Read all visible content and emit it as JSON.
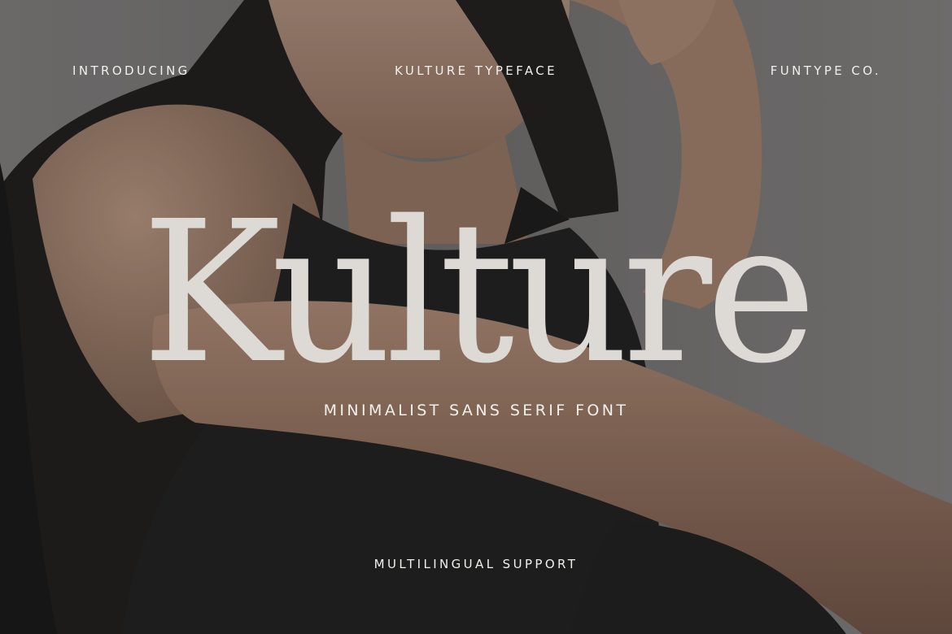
{
  "header": {
    "left": "INTRODUCING",
    "center": "KULTURE TYPEFACE",
    "right": "FUNTYPE CO."
  },
  "hero": {
    "title": "Kulture",
    "subtitle": "MINIMALIST SANS SERIF FONT"
  },
  "footer": {
    "text": "MULTILINGUAL SUPPORT"
  },
  "colors": {
    "text": "#f1efec",
    "title": "#dddad5",
    "background": "#6e6c6b",
    "skin": "#9a7a66",
    "dress": "#1c1c1c",
    "hair": "#161616"
  }
}
